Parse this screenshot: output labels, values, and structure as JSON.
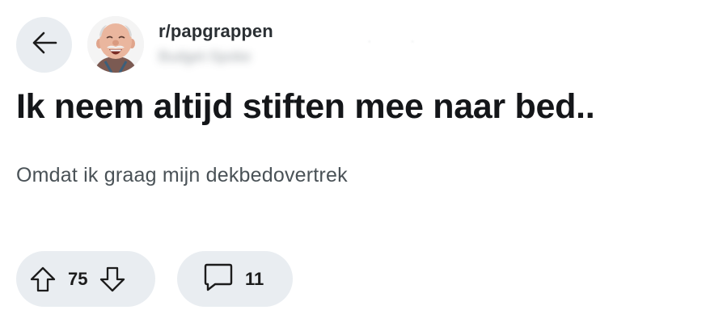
{
  "header": {
    "back_icon": "arrow-left-icon",
    "avatar_icon": "laughing-man-avatar",
    "subreddit": "r/papgrappen",
    "username": "Budget-Spoke"
  },
  "post": {
    "title": "Ik neem altijd stiften mee naar bed..",
    "body": "Omdat ik graag mijn dekbedovertrek"
  },
  "actions": {
    "upvote_icon": "arrow-up-icon",
    "downvote_icon": "arrow-down-icon",
    "vote_count": "75",
    "comment_icon": "speech-bubble-icon",
    "comment_count": "11"
  },
  "colors": {
    "pill_background": "#e9edf1",
    "title_text": "#141619",
    "body_text": "#4a5257"
  }
}
